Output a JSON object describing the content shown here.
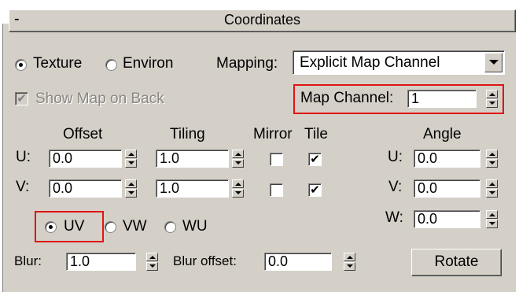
{
  "rollout": {
    "collapse_symbol": "-",
    "title": "Coordinates"
  },
  "mapping_type": {
    "texture_label": "Texture",
    "environ_label": "Environ",
    "selected": "Texture"
  },
  "mapping": {
    "label": "Mapping:",
    "value": "Explicit Map Channel"
  },
  "show_map_on_back": {
    "label": "Show Map on Back",
    "checked": true,
    "enabled": false
  },
  "map_channel": {
    "label": "Map Channel:",
    "value": "1"
  },
  "headers": {
    "offset": "Offset",
    "tiling": "Tiling",
    "mirror": "Mirror",
    "tile": "Tile",
    "angle": "Angle"
  },
  "rows": {
    "u": {
      "label": "U:",
      "offset": "0.0",
      "tiling": "1.0",
      "mirror": false,
      "tile": true
    },
    "v": {
      "label": "V:",
      "offset": "0.0",
      "tiling": "1.0",
      "mirror": false,
      "tile": true
    }
  },
  "angle": {
    "u": {
      "label": "U:",
      "value": "0.0"
    },
    "v": {
      "label": "V:",
      "value": "0.0"
    },
    "w": {
      "label": "W:",
      "value": "0.0"
    }
  },
  "projection_plane": {
    "options": [
      "UV",
      "VW",
      "WU"
    ],
    "selected": "UV"
  },
  "blur": {
    "label": "Blur:",
    "value": "1.0"
  },
  "blur_offset": {
    "label": "Blur offset:",
    "value": "0.0"
  },
  "rotate_button": "Rotate",
  "check_mark": "✔",
  "highlight_color": "#e01414"
}
